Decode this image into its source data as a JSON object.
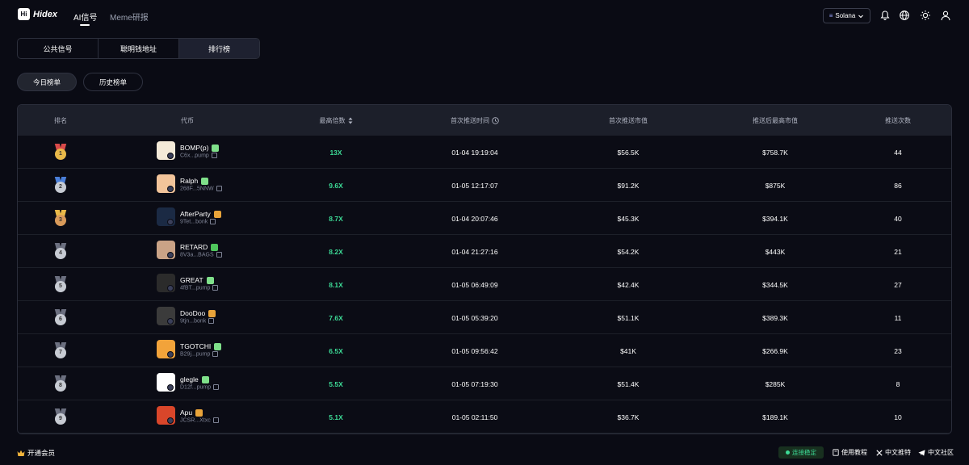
{
  "brand": {
    "name": "Hidex",
    "mark": "Hi"
  },
  "nav": {
    "items": [
      "AI信号",
      "Meme研报"
    ],
    "active": 0
  },
  "header": {
    "chain": "Solana"
  },
  "tabs": [
    "公共信号",
    "聪明钱地址",
    "排行榜"
  ],
  "lists": [
    "今日榜单",
    "历史榜单"
  ],
  "table": {
    "headers": [
      "排名",
      "代币",
      "最高倍数",
      "首次推送时间",
      "首次推送市值",
      "推送后最高市值",
      "推送次数"
    ],
    "rows": [
      {
        "rank": "1",
        "name": "BOMP(p)",
        "addr": "C6x...pump",
        "badge": "pill",
        "mult": "13X",
        "time": "01-04 19:19:04",
        "mcap": "$56.5K",
        "maxcap": "$758.7K",
        "count": "44"
      },
      {
        "rank": "2",
        "name": "Ralph",
        "addr": "268F...5NNW",
        "badge": "pill",
        "mult": "9.6X",
        "time": "01-05 12:17:07",
        "mcap": "$91.2K",
        "maxcap": "$875K",
        "count": "86"
      },
      {
        "rank": "3",
        "name": "AfterParty",
        "addr": "9Tet...bonk",
        "badge": "bonk",
        "mult": "8.7X",
        "time": "01-04 20:07:46",
        "mcap": "$45.3K",
        "maxcap": "$394.1K",
        "count": "40"
      },
      {
        "rank": "4",
        "name": "RETARD",
        "addr": "8V3a...BAGS",
        "badge": "bag",
        "mult": "8.2X",
        "time": "01-04 21:27:16",
        "mcap": "$54.2K",
        "maxcap": "$443K",
        "count": "21"
      },
      {
        "rank": "5",
        "name": "GREAT",
        "addr": "4fBT...pump",
        "badge": "pill",
        "mult": "8.1X",
        "time": "01-05 06:49:09",
        "mcap": "$42.4K",
        "maxcap": "$344.5K",
        "count": "27"
      },
      {
        "rank": "6",
        "name": "DooDoo",
        "addr": "9tjn...bonk",
        "badge": "bonk",
        "mult": "7.6X",
        "time": "01-05 05:39:20",
        "mcap": "$51.1K",
        "maxcap": "$389.3K",
        "count": "11"
      },
      {
        "rank": "7",
        "name": "TGOTCHI",
        "addr": "B29j...pump",
        "badge": "pill",
        "mult": "6.5X",
        "time": "01-05 09:56:42",
        "mcap": "$41K",
        "maxcap": "$266.9K",
        "count": "23"
      },
      {
        "rank": "8",
        "name": "glegle",
        "addr": "D12f...pump",
        "badge": "pill",
        "mult": "5.5X",
        "time": "01-05 07:19:30",
        "mcap": "$51.4K",
        "maxcap": "$285K",
        "count": "8"
      },
      {
        "rank": "9",
        "name": "Apu",
        "addr": "JCSR...Xtxc",
        "badge": "bonk",
        "mult": "5.1X",
        "time": "01-05 02:11:50",
        "mcap": "$36.7K",
        "maxcap": "$189.1K",
        "count": "10"
      }
    ]
  },
  "footer": {
    "vip": "开通会员",
    "status": "连接稳定",
    "tutorial": "使用教程",
    "twitter": "中文推特",
    "telegram": "中文社区"
  },
  "colors": {
    "accent_green": "#3ddc97",
    "gold": "#e9b949",
    "silver": "#c7cbd3",
    "bronze": "#d99a5a",
    "bg": "#0a0b14"
  }
}
